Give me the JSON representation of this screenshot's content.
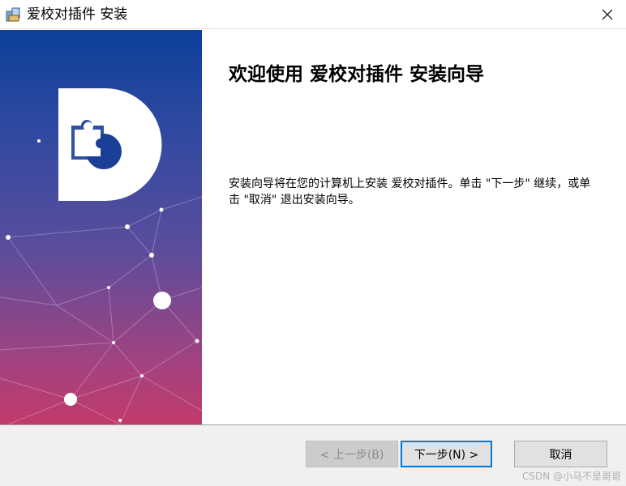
{
  "window": {
    "title": "爱校对插件 安装",
    "icon": "installer-icon",
    "close_icon": "close-icon"
  },
  "main": {
    "heading": "欢迎使用 爱校对插件 安装向导",
    "description": "安装向导将在您的计算机上安装 爱校对插件。单击 \"下一步\" 继续，或单击 \"取消\" 退出安装向导。"
  },
  "side_panel": {
    "logo": "puzzle-logo",
    "colors": {
      "top": "#0c3f9a",
      "bottom": "#c13a6a"
    }
  },
  "footer": {
    "back_label": "< 上一步(B)",
    "next_label": "下一步(N) >",
    "cancel_label": "取消",
    "watermark": "CSDN @小马不是哥哥"
  }
}
